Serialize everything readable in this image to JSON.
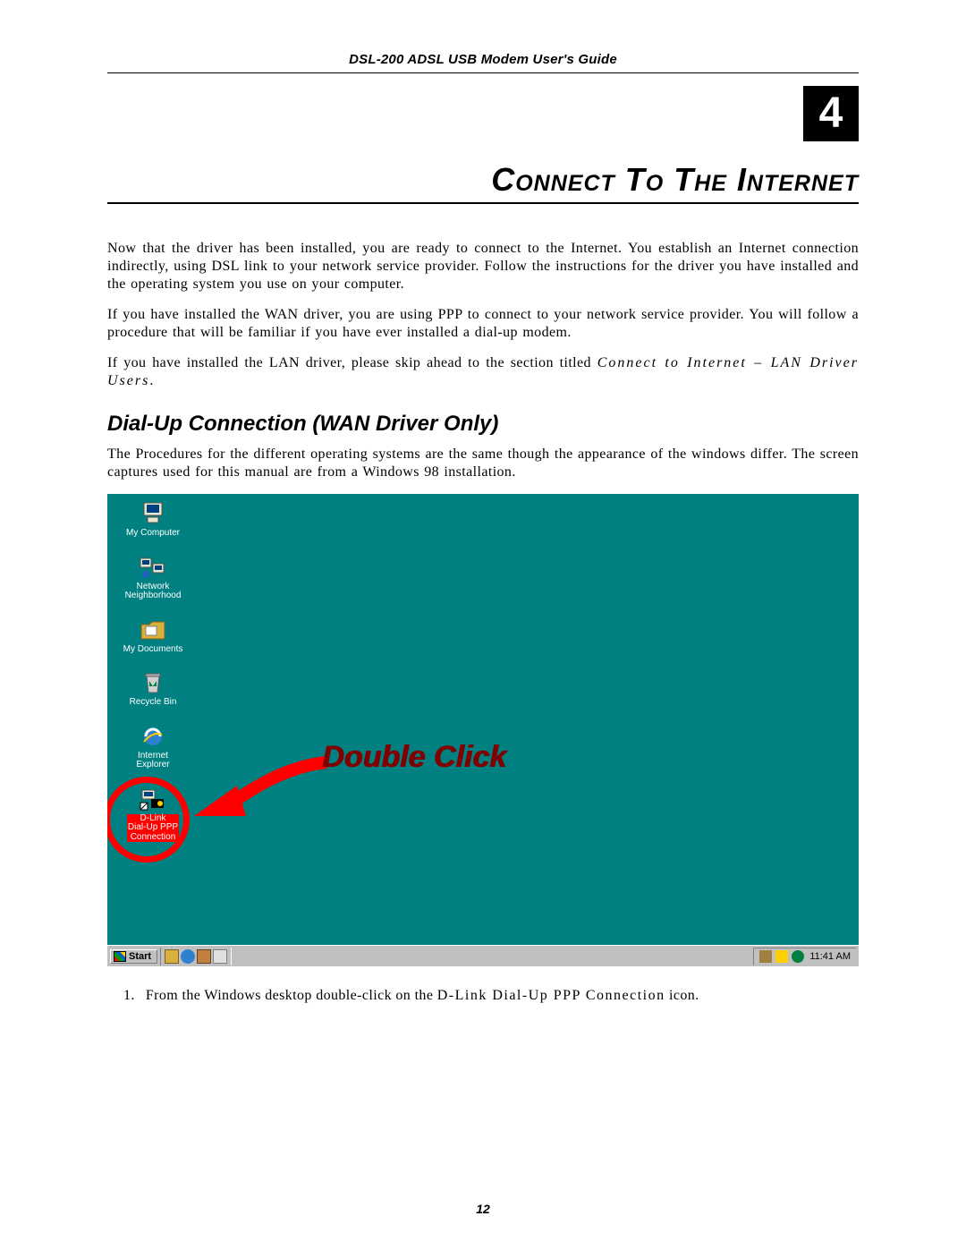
{
  "header": {
    "title": "DSL-200 ADSL USB Modem User's Guide"
  },
  "chapter": {
    "number": "4",
    "heading": "Connect To The Internet"
  },
  "paragraphs": {
    "p1": "Now that the driver has been installed, you are ready to connect to the Internet. You establish an Internet connection indirectly, using DSL link to your network service provider. Follow the instructions for the driver you have installed and the operating system you use on your computer.",
    "p2": "If you have installed the WAN driver, you are using PPP to connect to your network service provider. You will follow a procedure that will be familiar if you have ever installed a dial-up modem.",
    "p3_a": "If you have installed the LAN driver, please skip ahead to the section titled ",
    "p3_ital": "Connect to Internet – LAN Driver Users",
    "p3_b": "."
  },
  "section_heading": "Dial-Up Connection (WAN Driver Only)",
  "section_intro": "The Procedures for the different operating systems are the same though the appearance of the windows differ. The screen captures used for this manual are from a Windows 98 installation.",
  "desktop": {
    "annotation": "Double Click",
    "icons": [
      {
        "name": "my-computer-icon",
        "label": "My Computer"
      },
      {
        "name": "network-neighborhood-icon",
        "label": "Network\nNeighborhood"
      },
      {
        "name": "my-documents-icon",
        "label": "My Documents"
      },
      {
        "name": "recycle-bin-icon",
        "label": "Recycle Bin"
      },
      {
        "name": "internet-explorer-icon",
        "label": "Internet\nExplorer"
      },
      {
        "name": "dlink-dialup-icon",
        "label": "D-Link\nDial-Up PPP\nConnection",
        "highlighted": true
      }
    ],
    "taskbar": {
      "start": "Start",
      "clock": "11:41 AM"
    }
  },
  "steps": {
    "s1_num": "1.",
    "s1_a": "From the Windows desktop double-click on the ",
    "s1_spaced": "D-Link Dial-Up PPP Connection",
    "s1_b": " icon."
  },
  "page_number": "12"
}
